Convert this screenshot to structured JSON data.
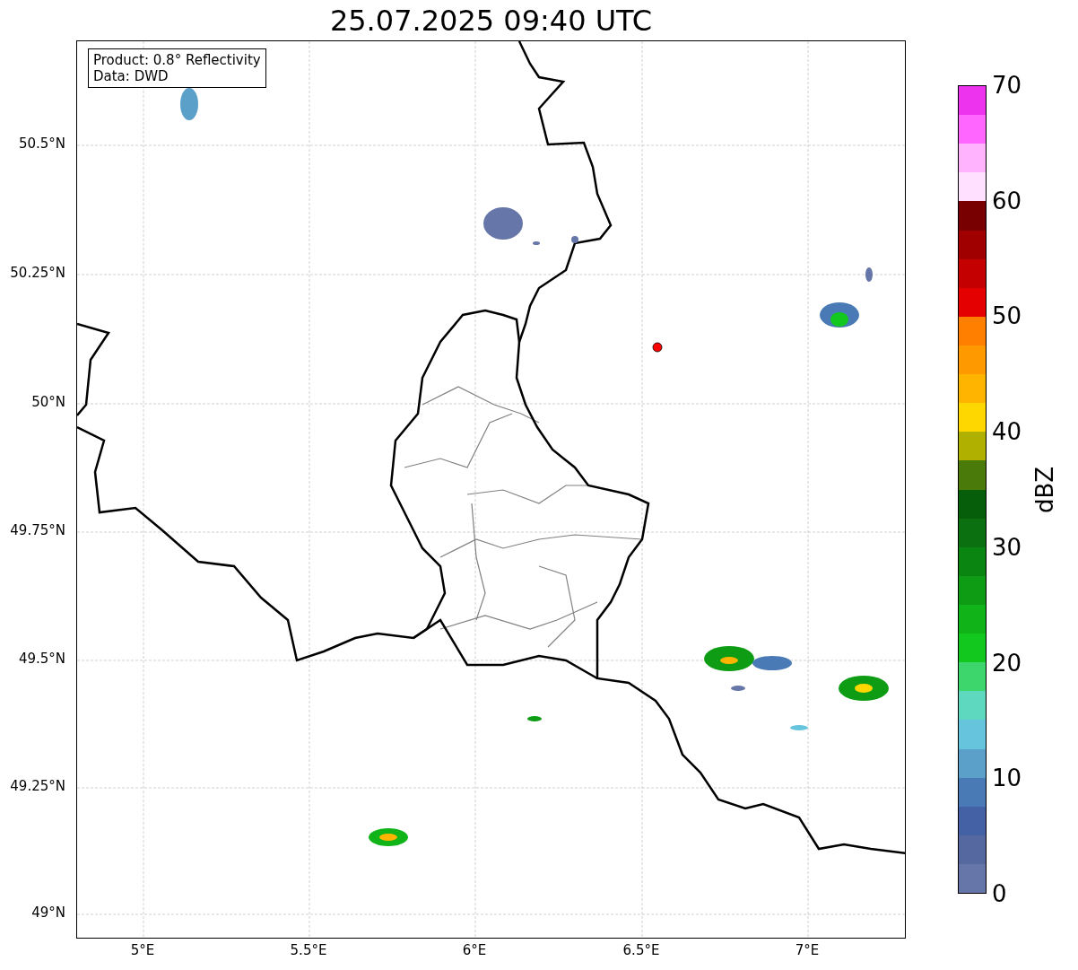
{
  "title": "25.07.2025 09:40 UTC",
  "info_box": {
    "lines": [
      "Product: 0.8° Reflectivity",
      "Data: DWD"
    ]
  },
  "y_ticks": [
    "50.5°N",
    "50.25°N",
    "50°N",
    "49.75°N",
    "49.5°N",
    "49.25°N",
    "49°N"
  ],
  "x_ticks": [
    "5°E",
    "5.5°E",
    "6°E",
    "6.5°E",
    "7°E"
  ],
  "colorbar": {
    "label": "dBZ",
    "ticks": [
      "70",
      "60",
      "50",
      "40",
      "30",
      "20",
      "10",
      "0"
    ],
    "bands": [
      {
        "color": "#ee33ee"
      },
      {
        "color": "#ff66ff"
      },
      {
        "color": "#ffb3ff"
      },
      {
        "color": "#ffe0ff"
      },
      {
        "color": "#780000"
      },
      {
        "color": "#a00000"
      },
      {
        "color": "#c40000"
      },
      {
        "color": "#e40000"
      },
      {
        "color": "#ff7f00"
      },
      {
        "color": "#ff9900"
      },
      {
        "color": "#ffb400"
      },
      {
        "color": "#ffd700"
      },
      {
        "color": "#b0b000"
      },
      {
        "color": "#4a7a0a"
      },
      {
        "color": "#075e0a"
      },
      {
        "color": "#0a7010"
      },
      {
        "color": "#0b8512"
      },
      {
        "color": "#0e9c14"
      },
      {
        "color": "#10b418"
      },
      {
        "color": "#12c81e"
      },
      {
        "color": "#3cd66c"
      },
      {
        "color": "#5fd8c0"
      },
      {
        "color": "#66c4dc"
      },
      {
        "color": "#5ba0c8"
      },
      {
        "color": "#4a7ab5"
      },
      {
        "color": "#4561a5"
      },
      {
        "color": "#5568a0"
      },
      {
        "color": "#6676a8"
      }
    ]
  }
}
